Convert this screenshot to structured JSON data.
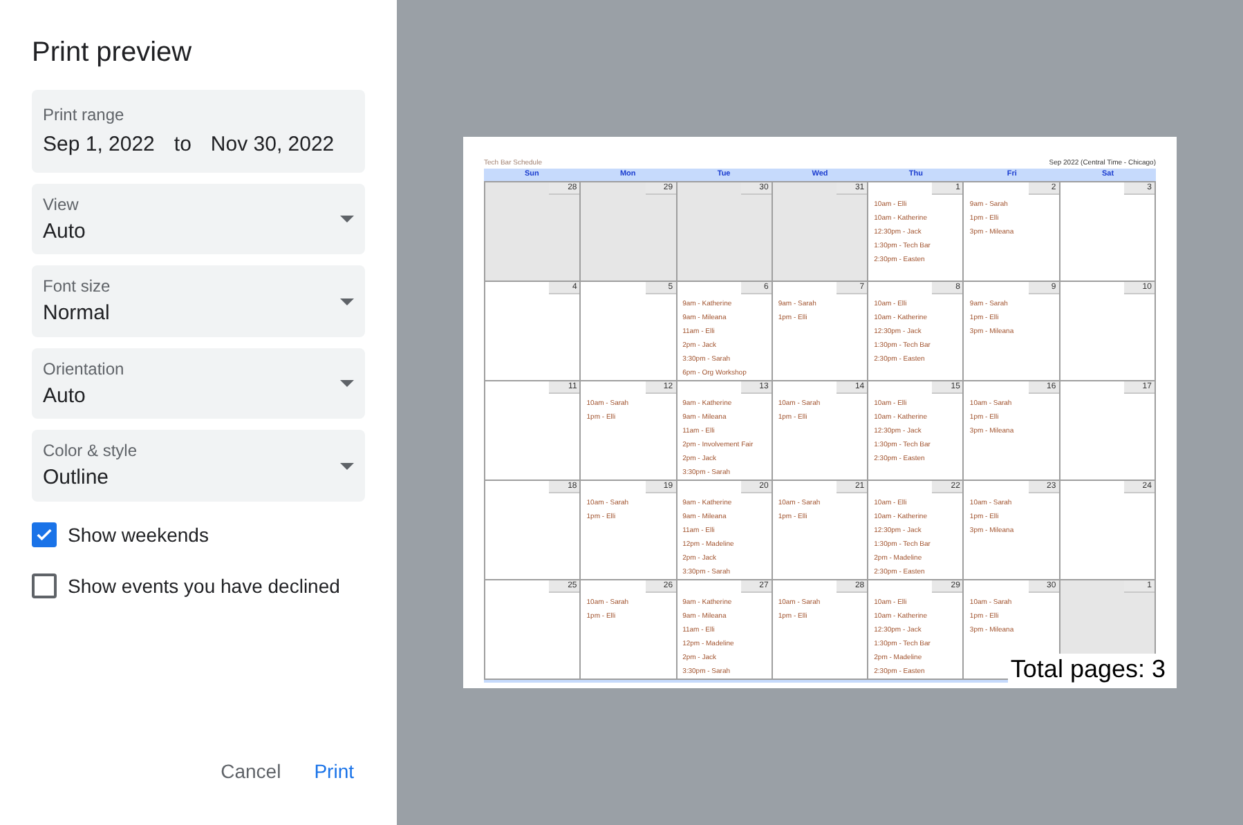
{
  "title": "Print preview",
  "print_range": {
    "label": "Print range",
    "from": "Sep 1, 2022",
    "separator": "to",
    "to": "Nov 30, 2022"
  },
  "selects": [
    {
      "label": "View",
      "value": "Auto"
    },
    {
      "label": "Font size",
      "value": "Normal"
    },
    {
      "label": "Orientation",
      "value": "Auto"
    },
    {
      "label": "Color & style",
      "value": "Outline"
    }
  ],
  "options": [
    {
      "label": "Show weekends",
      "checked": true
    },
    {
      "label": "Show events you have declined",
      "checked": false
    }
  ],
  "buttons": [
    {
      "label": "Cancel",
      "kind": "secondary"
    },
    {
      "label": "Print",
      "kind": "primary"
    }
  ],
  "calendar": {
    "title": "Tech Bar Schedule",
    "subtitle": "Sep 2022 (Central Time - Chicago)",
    "weekdays": [
      "Sun",
      "Mon",
      "Tue",
      "Wed",
      "Thu",
      "Fri",
      "Sat"
    ],
    "weeks": [
      [
        {
          "day": "28",
          "muted": true
        },
        {
          "day": "29",
          "muted": true
        },
        {
          "day": "30",
          "muted": true
        },
        {
          "day": "31",
          "muted": true
        },
        {
          "day": "1",
          "muted": false,
          "events": [
            "10am - Elli",
            "10am - Katherine",
            "12:30pm - Jack",
            "1:30pm - Tech Bar",
            "2:30pm - Easten"
          ]
        },
        {
          "day": "2",
          "muted": false,
          "events": [
            "9am - Sarah",
            "1pm - Elli",
            "3pm - Mileana"
          ]
        },
        {
          "day": "3",
          "muted": false
        }
      ],
      [
        {
          "day": "4",
          "muted": false
        },
        {
          "day": "5",
          "muted": false
        },
        {
          "day": "6",
          "muted": false,
          "events": [
            "9am - Katherine",
            "9am - Mileana",
            "11am - Elli",
            "2pm - Jack",
            "3:30pm - Sarah",
            "6pm - Org Workshop"
          ]
        },
        {
          "day": "7",
          "muted": false,
          "events": [
            "9am - Sarah",
            "1pm - Elli"
          ]
        },
        {
          "day": "8",
          "muted": false,
          "events": [
            "10am - Elli",
            "10am - Katherine",
            "12:30pm - Jack",
            "1:30pm - Tech Bar",
            "2:30pm - Easten"
          ]
        },
        {
          "day": "9",
          "muted": false,
          "events": [
            "9am - Sarah",
            "1pm - Elli",
            "3pm - Mileana"
          ]
        },
        {
          "day": "10",
          "muted": false
        }
      ],
      [
        {
          "day": "11",
          "muted": false
        },
        {
          "day": "12",
          "muted": false,
          "events": [
            "10am - Sarah",
            "1pm - Elli"
          ]
        },
        {
          "day": "13",
          "muted": false,
          "events": [
            "9am - Katherine",
            "9am - Mileana",
            "11am - Elli",
            "2pm - Involvement Fair",
            "2pm - Jack",
            "3:30pm - Sarah"
          ]
        },
        {
          "day": "14",
          "muted": false,
          "events": [
            "10am - Sarah",
            "1pm - Elli"
          ]
        },
        {
          "day": "15",
          "muted": false,
          "events": [
            "10am - Elli",
            "10am - Katherine",
            "12:30pm - Jack",
            "1:30pm - Tech Bar",
            "2:30pm - Easten"
          ]
        },
        {
          "day": "16",
          "muted": false,
          "events": [
            "10am - Sarah",
            "1pm - Elli",
            "3pm - Mileana"
          ]
        },
        {
          "day": "17",
          "muted": false
        }
      ],
      [
        {
          "day": "18",
          "muted": false
        },
        {
          "day": "19",
          "muted": false,
          "events": [
            "10am - Sarah",
            "1pm - Elli"
          ]
        },
        {
          "day": "20",
          "muted": false,
          "events": [
            "9am - Katherine",
            "9am - Mileana",
            "11am - Elli",
            "12pm - Madeline",
            "2pm - Jack",
            "3:30pm - Sarah"
          ]
        },
        {
          "day": "21",
          "muted": false,
          "events": [
            "10am - Sarah",
            "1pm - Elli"
          ]
        },
        {
          "day": "22",
          "muted": false,
          "events": [
            "10am - Elli",
            "10am - Katherine",
            "12:30pm - Jack",
            "1:30pm - Tech Bar",
            "2pm - Madeline",
            "2:30pm - Easten"
          ]
        },
        {
          "day": "23",
          "muted": false,
          "events": [
            "10am - Sarah",
            "1pm - Elli",
            "3pm - Mileana"
          ]
        },
        {
          "day": "24",
          "muted": false
        }
      ],
      [
        {
          "day": "25",
          "muted": false
        },
        {
          "day": "26",
          "muted": false,
          "events": [
            "10am - Sarah",
            "1pm - Elli"
          ]
        },
        {
          "day": "27",
          "muted": false,
          "events": [
            "9am - Katherine",
            "9am - Mileana",
            "11am - Elli",
            "12pm - Madeline",
            "2pm - Jack",
            "3:30pm - Sarah"
          ]
        },
        {
          "day": "28",
          "muted": false,
          "events": [
            "10am - Sarah",
            "1pm - Elli"
          ]
        },
        {
          "day": "29",
          "muted": false,
          "events": [
            "10am - Elli",
            "10am - Katherine",
            "12:30pm - Jack",
            "1:30pm - Tech Bar",
            "2pm - Madeline",
            "2:30pm - Easten"
          ]
        },
        {
          "day": "30",
          "muted": false,
          "events": [
            "10am - Sarah",
            "1pm - Elli",
            "3pm - Mileana"
          ]
        },
        {
          "day": "1",
          "muted": true
        }
      ]
    ]
  },
  "total_pages": "Total pages: 3"
}
